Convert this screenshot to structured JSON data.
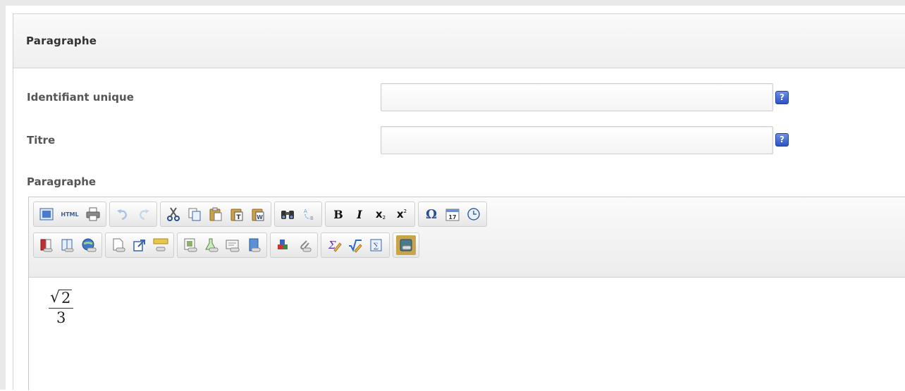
{
  "panel": {
    "title": "Paragraphe"
  },
  "fields": [
    {
      "label": "Identifiant unique",
      "value": "",
      "help": "?"
    },
    {
      "label": "Titre",
      "value": "",
      "help": "?"
    }
  ],
  "editor": {
    "label": "Paragraphe",
    "toolbar": {
      "html_label": "HTML",
      "bold": "B",
      "italic": "I",
      "subscript": "x",
      "superscript": "x",
      "omega": "Ω"
    },
    "content": {
      "formula": {
        "radicand": "2",
        "denominator": "3"
      }
    }
  },
  "colors": {
    "help_icon": "#2d53c4",
    "panel_header": "#efefef",
    "label_text": "#555555"
  }
}
